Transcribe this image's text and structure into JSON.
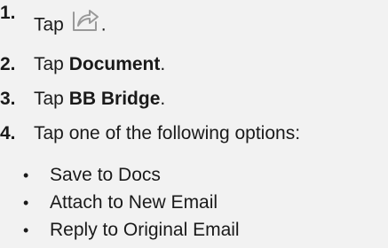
{
  "steps": [
    {
      "number": "1.",
      "prefix": "Tap ",
      "icon": "share-icon",
      "suffix": "."
    },
    {
      "number": "2.",
      "prefix": "Tap ",
      "bold": "Document",
      "suffix": "."
    },
    {
      "number": "3.",
      "prefix": "Tap ",
      "bold": "BB Bridge",
      "suffix": "."
    },
    {
      "number": "4.",
      "text": "Tap one of the following options:"
    }
  ],
  "options": [
    {
      "bullet": "•",
      "label": "Save to Docs"
    },
    {
      "bullet": "•",
      "label": "Attach to New Email"
    },
    {
      "bullet": "•",
      "label": "Reply to Original Email"
    }
  ],
  "colors": {
    "background": "#f2f2f2",
    "text": "#1a1a1a",
    "icon": "#999999"
  }
}
